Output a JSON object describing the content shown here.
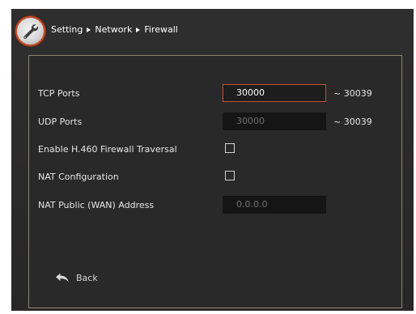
{
  "header": {
    "breadcrumb": [
      "Setting",
      "Network",
      "Firewall"
    ],
    "icon": "wrench-icon"
  },
  "fields": {
    "tcp_ports": {
      "label": "TCP Ports",
      "value": "30000",
      "range_end": "~ 30039"
    },
    "udp_ports": {
      "label": "UDP Ports",
      "value": "30000",
      "range_end": "~ 30039"
    },
    "h460": {
      "label": "Enable H.460 Firewall Traversal",
      "checked": false
    },
    "nat_config": {
      "label": "NAT Configuration",
      "checked": false
    },
    "nat_public": {
      "label": "NAT Public (WAN) Address",
      "value": "0.0.0.0"
    }
  },
  "back_button": {
    "label": "Back",
    "icon": "back-arrow-icon"
  },
  "colors": {
    "accent": "#c8502e",
    "background": "#2b2a2a",
    "panel_border": "#8a8672"
  }
}
